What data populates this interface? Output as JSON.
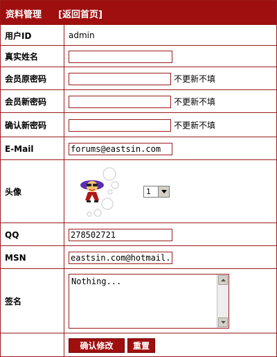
{
  "header": {
    "title": "资料管理",
    "back_link": "[返回首页]"
  },
  "fields": {
    "userid": {
      "label": "用户ID",
      "value": "admin"
    },
    "realname": {
      "label": "真实姓名",
      "value": ""
    },
    "old_password": {
      "label": "会员原密码",
      "value": "",
      "note": "不更新不填"
    },
    "new_password": {
      "label": "会员新密码",
      "value": "",
      "note": "不更新不填"
    },
    "confirm_password": {
      "label": "确认新密码",
      "value": "",
      "note": "不更新不填"
    },
    "email": {
      "label": "E-Mail",
      "value": "forums@eastsin.com"
    },
    "avatar": {
      "label": "头像",
      "selected": "1"
    },
    "qq": {
      "label": "QQ",
      "value": "278502721"
    },
    "msn": {
      "label": "MSN",
      "value": "eastsin.com@hotmail.c"
    },
    "signature": {
      "label": "签名",
      "value": "Nothing..."
    }
  },
  "actions": {
    "submit_label": "确认修改",
    "reset_label": "重置"
  },
  "colors": {
    "accent": "#a00f0f",
    "border": "#9b1a1a"
  }
}
